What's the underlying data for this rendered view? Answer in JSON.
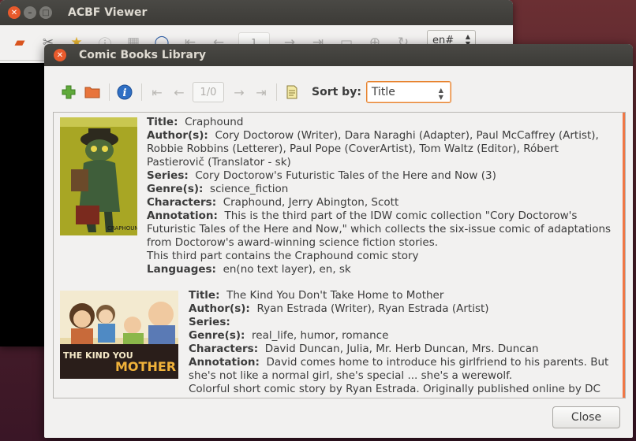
{
  "back_window": {
    "title": "ACBF Viewer",
    "page_field": "1",
    "language": "en#"
  },
  "dialog": {
    "title": "Comic Books Library",
    "page_indicator": "1/0",
    "sort_label": "Sort by:",
    "sort_value": "Title",
    "close_label": "Close"
  },
  "books": [
    {
      "title_key": "Title:",
      "title": "Craphound",
      "authors_key": "Author(s):",
      "authors_lines": [
        "Cory Doctorow (Writer), Dara Naraghi (Adapter), Paul McCaffrey (Artist),",
        "Robbie Robbins (Letterer), Paul Pope (CoverArtist), Tom Waltz (Editor), Róbert",
        "Pastierovič (Translator - sk)"
      ],
      "series_key": "Series:",
      "series": "Cory Doctorow's Futuristic Tales of the Here and Now (3)",
      "genre_key": "Genre(s):",
      "genres": "science_fiction",
      "characters_key": "Characters:",
      "characters": "Craphound, Jerry Abington, Scott",
      "annotation_key": "Annotation:",
      "annotation_lines": [
        "This is the third part of the IDW comic collection \"Cory Doctorow's",
        "Futuristic Tales of the Here and Now,\" which collects the six-issue comic of adaptations",
        "from Doctorow's award-winning science fiction stories.",
        "This third part contains the Craphound comic story"
      ],
      "languages_key": "Languages:",
      "languages": "en(no text layer), en, sk",
      "cover_text": "CRAPHOUND"
    },
    {
      "title_key": "Title:",
      "title": "The Kind You Don't Take Home to Mother",
      "authors_key": "Author(s):",
      "authors": "Ryan Estrada (Writer), Ryan Estrada (Artist)",
      "series_key": "Series:",
      "genre_key": "Genre(s):",
      "genres": "real_life, humor, romance",
      "characters_key": "Characters:",
      "characters": "David Duncan, Julia, Mr. Herb Duncan, Mrs. Duncan",
      "annotation_key": "Annotation:",
      "annotation_lines": [
        "David comes home to introduce his girlfriend to his parents. But",
        "she's not like a normal girl, she's special ... she's a werewolf.",
        "Colorful short comic story by Ryan Estrada. Originally published online by DC"
      ],
      "cover_text_1": "THE KIND YOU",
      "cover_text_2": "MOTHER"
    }
  ],
  "colors": {
    "accent": "#f07746",
    "title_bar": "#3c3b37",
    "window_bg": "#f2f1f0"
  }
}
